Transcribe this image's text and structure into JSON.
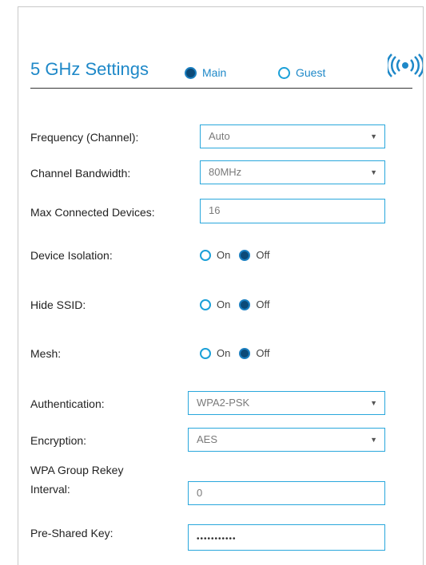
{
  "section": {
    "title": "5 GHz Settings",
    "network_options": [
      {
        "label": "Main",
        "selected": true
      },
      {
        "label": "Guest",
        "selected": false
      }
    ],
    "icon": "wireless-broadcast-icon"
  },
  "fields": {
    "frequency": {
      "label": "Frequency (Channel):",
      "value": "Auto"
    },
    "bandwidth": {
      "label": "Channel Bandwidth:",
      "value": "80MHz"
    },
    "max_devices": {
      "label": "Max Connected Devices:",
      "value": "16"
    },
    "isolation": {
      "label": "Device Isolation:",
      "on_label": "On",
      "off_label": "Off",
      "selected": "Off"
    },
    "hide_ssid": {
      "label": "Hide SSID:",
      "on_label": "On",
      "off_label": "Off",
      "selected": "Off"
    },
    "mesh": {
      "label": "Mesh:",
      "on_label": "On",
      "off_label": "Off",
      "selected": "Off"
    },
    "authentication": {
      "label": "Authentication:",
      "value": "WPA2-PSK"
    },
    "encryption": {
      "label": "Encryption:",
      "value": "AES"
    },
    "rekey": {
      "label_line1": "WPA Group Rekey",
      "label_line2": "Interval:",
      "value": "0"
    },
    "psk": {
      "label": "Pre-Shared Key:",
      "value": "•••••••••••"
    }
  },
  "colors": {
    "accent": "#1e88c8",
    "border": "#29a7dc",
    "radio_selected": "#0b4a78"
  }
}
